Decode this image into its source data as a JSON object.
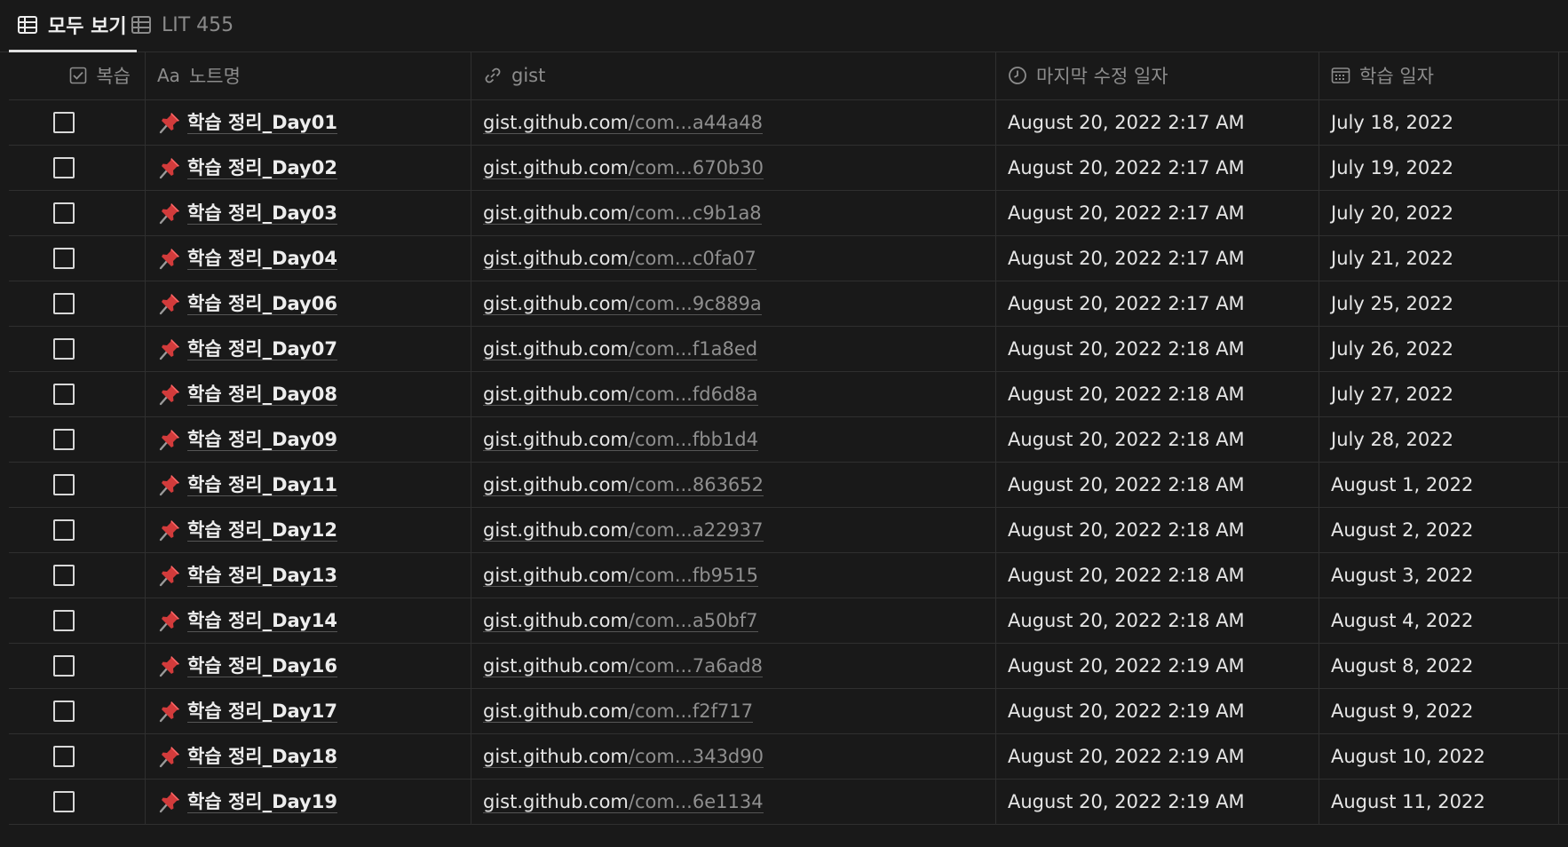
{
  "tabs": [
    {
      "label": "모두 보기",
      "icon": "table-icon",
      "active": true
    },
    {
      "label": "LIT 455",
      "icon": "table-icon",
      "active": false
    }
  ],
  "columns": {
    "review": "복습",
    "name_prefix": "Aa",
    "name": "노트명",
    "gist": "gist",
    "modified": "마지막 수정 일자",
    "study_date": "학습 일자"
  },
  "rows": [
    {
      "name": "학습 정리_Day01",
      "gist_host": "gist.github.com",
      "gist_path": "/com...a44a48",
      "modified": "August 20, 2022 2:17 AM",
      "study_date": "July 18, 2022"
    },
    {
      "name": "학습 정리_Day02",
      "gist_host": "gist.github.com",
      "gist_path": "/com...670b30",
      "modified": "August 20, 2022 2:17 AM",
      "study_date": "July 19, 2022"
    },
    {
      "name": "학습 정리_Day03",
      "gist_host": "gist.github.com",
      "gist_path": "/com...c9b1a8",
      "modified": "August 20, 2022 2:17 AM",
      "study_date": "July 20, 2022"
    },
    {
      "name": "학습 정리_Day04",
      "gist_host": "gist.github.com",
      "gist_path": "/com...c0fa07",
      "modified": "August 20, 2022 2:17 AM",
      "study_date": "July 21, 2022"
    },
    {
      "name": "학습 정리_Day06",
      "gist_host": "gist.github.com",
      "gist_path": "/com...9c889a",
      "modified": "August 20, 2022 2:17 AM",
      "study_date": "July 25, 2022"
    },
    {
      "name": "학습 정리_Day07",
      "gist_host": "gist.github.com",
      "gist_path": "/com...f1a8ed",
      "modified": "August 20, 2022 2:18 AM",
      "study_date": "July 26, 2022"
    },
    {
      "name": "학습 정리_Day08",
      "gist_host": "gist.github.com",
      "gist_path": "/com...fd6d8a",
      "modified": "August 20, 2022 2:18 AM",
      "study_date": "July 27, 2022"
    },
    {
      "name": "학습 정리_Day09",
      "gist_host": "gist.github.com",
      "gist_path": "/com...fbb1d4",
      "modified": "August 20, 2022 2:18 AM",
      "study_date": "July 28, 2022"
    },
    {
      "name": "학습 정리_Day11",
      "gist_host": "gist.github.com",
      "gist_path": "/com...863652",
      "modified": "August 20, 2022 2:18 AM",
      "study_date": "August 1, 2022"
    },
    {
      "name": "학습 정리_Day12",
      "gist_host": "gist.github.com",
      "gist_path": "/com...a22937",
      "modified": "August 20, 2022 2:18 AM",
      "study_date": "August 2, 2022"
    },
    {
      "name": "학습 정리_Day13",
      "gist_host": "gist.github.com",
      "gist_path": "/com...fb9515",
      "modified": "August 20, 2022 2:18 AM",
      "study_date": "August 3, 2022"
    },
    {
      "name": "학습 정리_Day14",
      "gist_host": "gist.github.com",
      "gist_path": "/com...a50bf7",
      "modified": "August 20, 2022 2:18 AM",
      "study_date": "August 4, 2022"
    },
    {
      "name": "학습 정리_Day16",
      "gist_host": "gist.github.com",
      "gist_path": "/com...7a6ad8",
      "modified": "August 20, 2022 2:19 AM",
      "study_date": "August 8, 2022"
    },
    {
      "name": "학습 정리_Day17",
      "gist_host": "gist.github.com",
      "gist_path": "/com...f2f717",
      "modified": "August 20, 2022 2:19 AM",
      "study_date": "August 9, 2022"
    },
    {
      "name": "학습 정리_Day18",
      "gist_host": "gist.github.com",
      "gist_path": "/com...343d90",
      "modified": "August 20, 2022 2:19 AM",
      "study_date": "August 10, 2022"
    },
    {
      "name": "학습 정리_Day19",
      "gist_host": "gist.github.com",
      "gist_path": "/com...6e1134",
      "modified": "August 20, 2022 2:19 AM",
      "study_date": "August 11, 2022"
    }
  ],
  "row_icon": "pushpin-icon",
  "colors": {
    "background": "#191919",
    "border": "#2f2f2f",
    "text": "#e6e6e6",
    "muted": "#8c8c8c",
    "pin_red": "#d23b3b"
  }
}
